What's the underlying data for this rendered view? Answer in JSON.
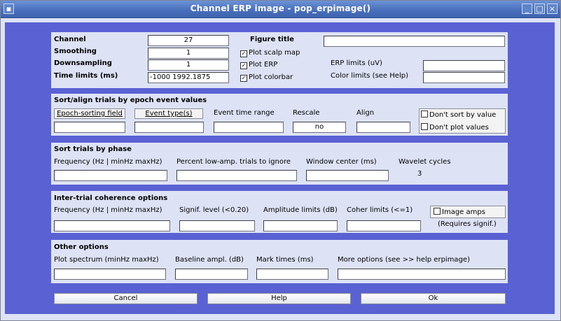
{
  "window": {
    "title": "Channel ERP image - pop_erpimage()",
    "controls": [
      "menu-icon",
      "minimize-icon",
      "maximize-icon",
      "close-icon"
    ]
  },
  "top": {
    "channel_label": "Channel",
    "channel_value": "27",
    "smoothing_label": "Smoothing",
    "smoothing_value": "1",
    "downsampling_label": "Downsampling",
    "downsampling_value": "1",
    "time_limits_label": "Time limits (ms)",
    "time_limits_value": "-1000   1992.1875",
    "figure_title_label": "Figure title",
    "figure_title_value": "",
    "plot_scalp_map": "Plot scalp map",
    "plot_erp": "Plot ERP",
    "plot_colorbar": "Plot colorbar",
    "erp_limits_label": "ERP limits (uV)",
    "erp_limits_value": "",
    "color_limits_label": "Color limits (see Help)",
    "color_limits_value": ""
  },
  "sort": {
    "heading": "Sort/align trials by epoch event values",
    "epoch_field_btn": "Epoch-sorting field",
    "event_types_btn": "Event type(s)",
    "event_time_range_label": "Event time range",
    "rescale_label": "Rescale",
    "rescale_value": "no",
    "align_label": "Align",
    "dont_sort": "Don't sort by value",
    "dont_plot": "Don't plot values"
  },
  "phase": {
    "heading": "Sort trials by phase",
    "frequency_label": "Frequency (Hz | minHz maxHz)",
    "percent_label": "Percent low-amp. trials to ignore",
    "window_center_label": "Window center (ms)",
    "wavelet_label": "Wavelet cycles",
    "wavelet_value": "3"
  },
  "coherence": {
    "heading": "Inter-trial coherence options",
    "frequency_label": "Frequency (Hz | minHz maxHz)",
    "signif_label": "Signif. level (<0.20)",
    "amplitude_label": "Amplitude limits (dB)",
    "coher_label": "Coher limits (<=1)",
    "image_amps": "Image amps",
    "requires_signif": "(Requires signif.)"
  },
  "other": {
    "heading": "Other options",
    "plot_spectrum_label": "Plot spectrum (minHz maxHz)",
    "baseline_label": "Baseline ampl. (dB)",
    "mark_times_label": "Mark times (ms)",
    "more_options_label": "More options (see >> help erpimage)"
  },
  "buttons": {
    "cancel": "Cancel",
    "help": "Help",
    "ok": "Ok"
  },
  "colors": {
    "background": "#5961d3",
    "panel": "#dde2f4",
    "titlebar": "#4a70bd"
  }
}
